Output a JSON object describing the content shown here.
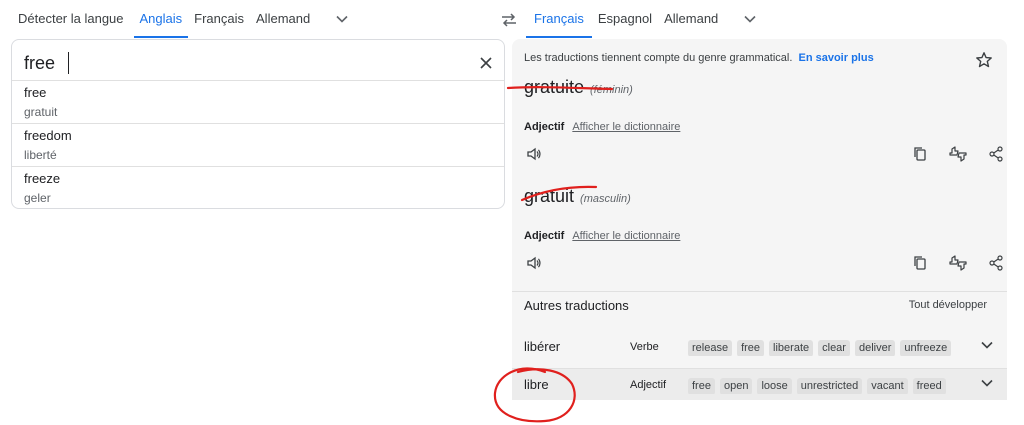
{
  "source_langs": {
    "tabs": [
      "Détecter la langue",
      "Anglais",
      "Français",
      "Allemand"
    ],
    "active": 1
  },
  "target_langs": {
    "tabs": [
      "Français",
      "Espagnol",
      "Allemand"
    ],
    "active": 0
  },
  "source": {
    "text": "free",
    "suggestions": [
      {
        "word": "free",
        "translation": "gratuit"
      },
      {
        "word": "freedom",
        "translation": "liberté"
      },
      {
        "word": "freeze",
        "translation": "geler"
      }
    ]
  },
  "result": {
    "gender_note": "Les traductions tiennent compte du genre grammatical.",
    "learn_more": "En savoir plus",
    "translations": [
      {
        "word": "gratuite",
        "gender": "(féminin)",
        "pos": "Adjectif",
        "dict_link": "Afficher le dictionnaire"
      },
      {
        "word": "gratuit",
        "gender": "(masculin)",
        "pos": "Adjectif",
        "dict_link": "Afficher le dictionnaire"
      }
    ]
  },
  "other": {
    "title": "Autres traductions",
    "expand_all": "Tout développer",
    "rows": [
      {
        "word": "libérer",
        "pos": "Verbe",
        "chips": [
          "release",
          "free",
          "liberate",
          "clear",
          "deliver",
          "unfreeze"
        ]
      },
      {
        "word": "libre",
        "pos": "Adjectif",
        "chips": [
          "free",
          "open",
          "loose",
          "unrestricted",
          "vacant",
          "freed"
        ]
      }
    ]
  },
  "colors": {
    "accent": "#1a73e8",
    "annotation": "#e0201d",
    "panel_bg": "#f5f5f5"
  }
}
